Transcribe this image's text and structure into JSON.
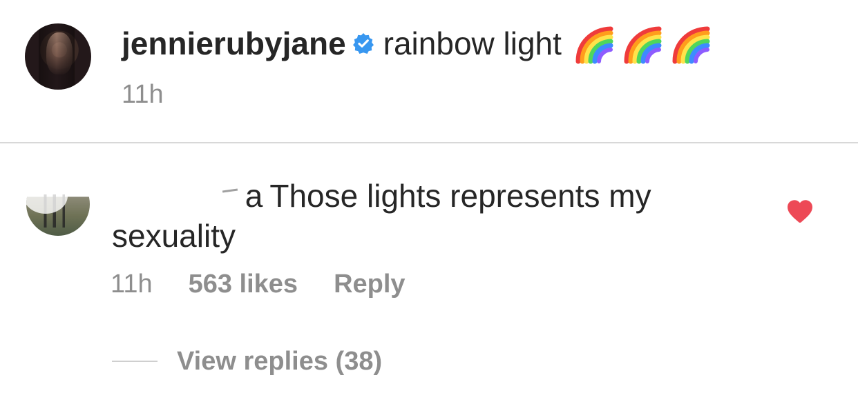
{
  "post": {
    "username": "jennierubyjane",
    "caption": "rainbow light",
    "time": "11h",
    "verified_icon": "verified-badge-icon",
    "emoji_icons": [
      "rainbow-emoji-icon",
      "rainbow-emoji-icon",
      "rainbow-emoji-icon"
    ]
  },
  "comment": {
    "text": "Those lights represents my sexuality",
    "time": "11h",
    "likes": "563 likes",
    "reply_label": "Reply",
    "liked_icon": "heart-icon",
    "view_replies_label": "View replies (38)"
  },
  "colors": {
    "text": "#262626",
    "secondary_text": "#8e8e8e",
    "verified_blue": "#3897f0",
    "liked_red": "#ed4956",
    "divider": "#d8d8d8"
  }
}
